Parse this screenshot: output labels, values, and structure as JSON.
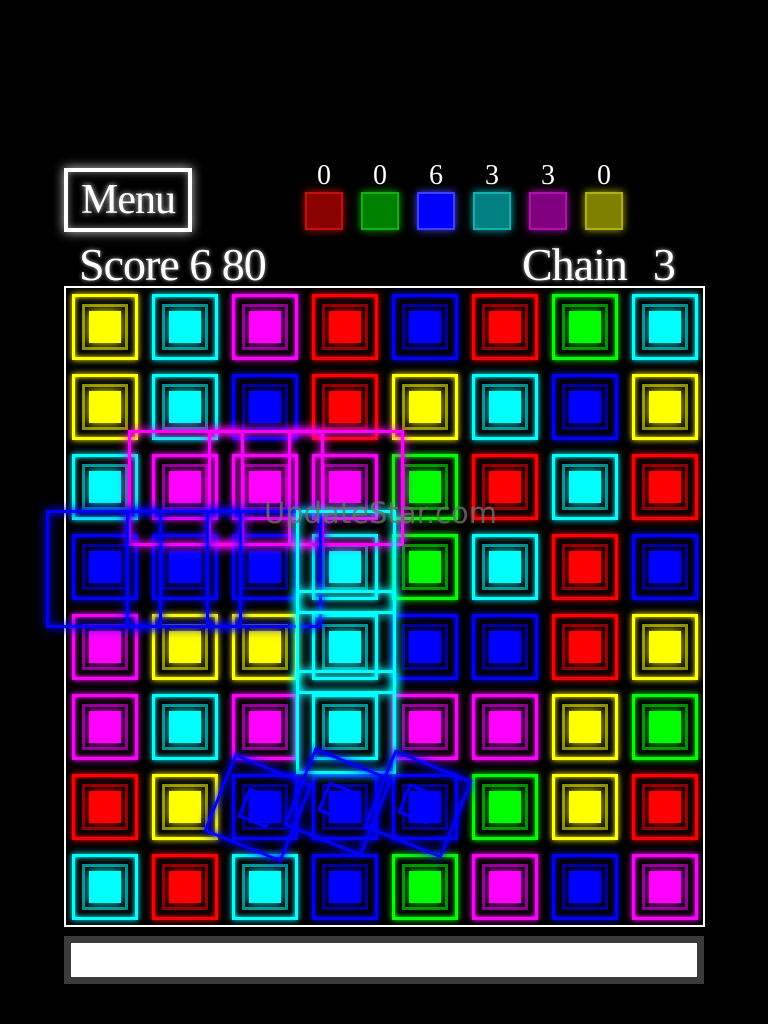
{
  "menu": {
    "label": "Menu"
  },
  "counters": [
    {
      "value": "0",
      "color": "#8b0000",
      "border": "#c01010"
    },
    {
      "value": "0",
      "color": "#008000",
      "border": "#10b010"
    },
    {
      "value": "6",
      "color": "#0000ff",
      "border": "#4040ff"
    },
    {
      "value": "3",
      "color": "#008080",
      "border": "#10b0b0"
    },
    {
      "value": "3",
      "color": "#800080",
      "border": "#b010b0"
    },
    {
      "value": "0",
      "color": "#808000",
      "border": "#b0b010"
    }
  ],
  "score": {
    "label": "Score",
    "value": "6 80"
  },
  "chain": {
    "label": "Chain",
    "value": "3"
  },
  "colors": {
    "Y": "#ffff00",
    "C": "#00ffff",
    "M": "#ff00ff",
    "R": "#ff0000",
    "B": "#0000ff",
    "G": "#00ff00"
  },
  "grid": [
    [
      "Y",
      "C",
      "M",
      "R",
      "B",
      "R",
      "G",
      "C"
    ],
    [
      "Y",
      "C",
      "B",
      "R",
      "Y",
      "C",
      "B",
      "Y"
    ],
    [
      "C",
      "M",
      "M",
      "M",
      "G",
      "R",
      "C",
      "R"
    ],
    [
      "B",
      "B",
      "B",
      "C",
      "G",
      "C",
      "R",
      "B"
    ],
    [
      "M",
      "Y",
      "Y",
      "C",
      "B",
      "B",
      "R",
      "Y"
    ],
    [
      "M",
      "C",
      "M",
      "C",
      "M",
      "M",
      "Y",
      "G"
    ],
    [
      "R",
      "Y",
      "B",
      "B",
      "B",
      "G",
      "Y",
      "R"
    ],
    [
      "C",
      "R",
      "C",
      "B",
      "G",
      "M",
      "B",
      "M"
    ]
  ],
  "watermark": "UpdateStar.com",
  "progress": {
    "fill": 1.0
  }
}
